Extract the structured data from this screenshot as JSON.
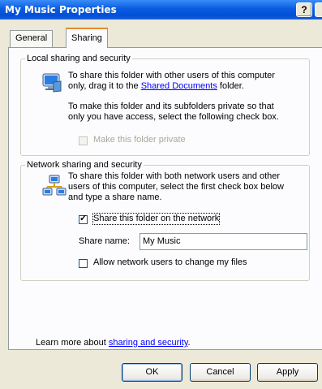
{
  "window": {
    "title": "My Music Properties",
    "help_label": "?"
  },
  "tabs": [
    {
      "label": "General"
    },
    {
      "label": "Sharing"
    }
  ],
  "local": {
    "group_label": "Local sharing and security",
    "text1": "To share this folder with other users of this computer",
    "text2_pre": "only, drag it to the ",
    "link": "Shared Documents",
    "text2_post": " folder.",
    "text3": "To make this folder and its subfolders private so that",
    "text4": "only you have access, select the following check box.",
    "private_label": "Make this folder private",
    "private_checked": false,
    "private_enabled": false
  },
  "network": {
    "group_label": "Network sharing and security",
    "text1": "To share this folder with both network users and other",
    "text2": "users of this computer, select the first check box below",
    "text3": "and type a share name.",
    "share_label": "Share this folder on the network",
    "share_checked": true,
    "share_name_label": "Share name:",
    "share_name_value": "My Music",
    "allow_label": "Allow network users to change my files",
    "allow_checked": false
  },
  "learn": {
    "pre": "Learn more about ",
    "link": "sharing and security",
    "post": "."
  },
  "buttons": {
    "ok": "OK",
    "cancel": "Cancel",
    "apply": "Apply"
  },
  "colors": {
    "title_bar": "#0a5ce0",
    "link": "#0000ff",
    "dialog_bg": "#ece9d8"
  }
}
